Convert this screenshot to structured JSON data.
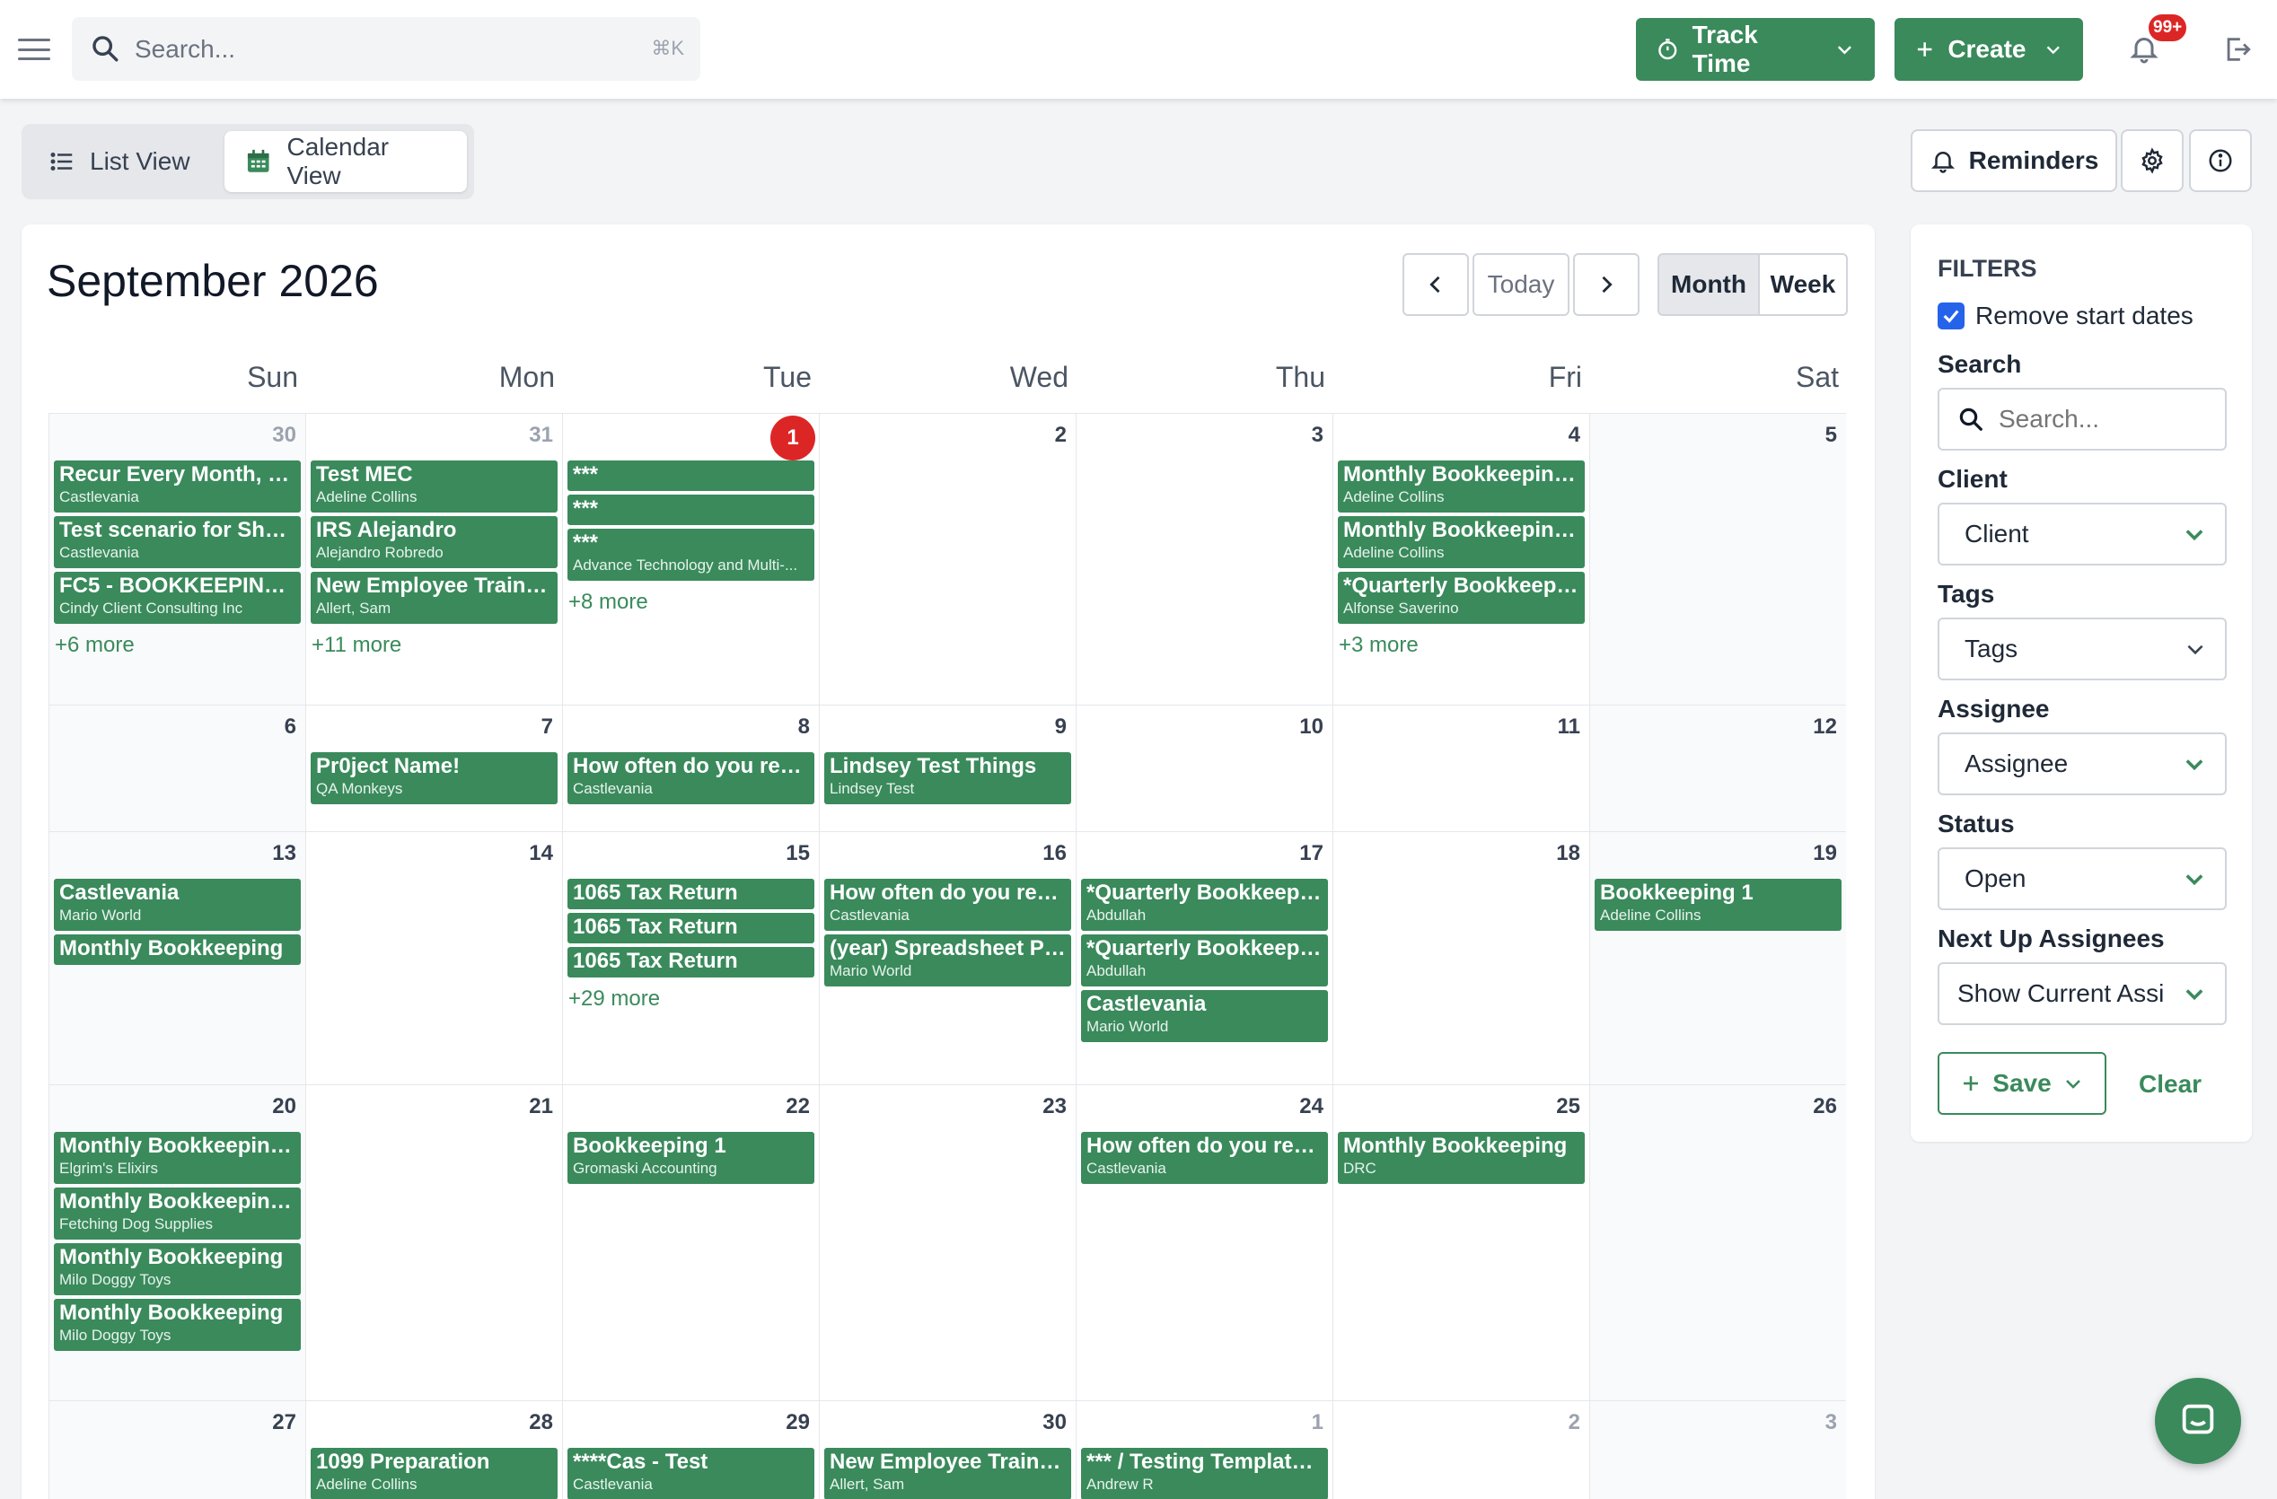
{
  "topbar": {
    "search_placeholder": "Search...",
    "search_shortcut": "⌘K",
    "track_time_label": "Track Time",
    "create_label": "Create",
    "notification_count": "99+"
  },
  "views": {
    "list_label": "List View",
    "calendar_label": "Calendar View"
  },
  "actions": {
    "reminders_label": "Reminders"
  },
  "calendar": {
    "title": "September 2026",
    "today_label": "Today",
    "month_label": "Month",
    "week_label": "Week",
    "weekdays": [
      "Sun",
      "Mon",
      "Tue",
      "Wed",
      "Thu",
      "Fri",
      "Sat"
    ],
    "weeks": [
      [
        {
          "day": "30",
          "muted": true,
          "events": [
            {
              "title": "Recur Every Month, se...",
              "sub": "Castlevania"
            },
            {
              "title": "Test scenario for Shaw...",
              "sub": "Castlevania"
            },
            {
              "title": "FC5 - BOOKKEEPING ...",
              "sub": "Cindy Client Consulting Inc"
            }
          ],
          "more": "+6 more"
        },
        {
          "day": "31",
          "muted": true,
          "events": [
            {
              "title": "Test MEC",
              "sub": "Adeline Collins"
            },
            {
              "title": "IRS Alejandro",
              "sub": "Alejandro Robredo"
            },
            {
              "title": "New Employee Trainin...",
              "sub": "Allert, Sam"
            }
          ],
          "more": "+11 more"
        },
        {
          "day": "1",
          "today": true,
          "events": [
            {
              "title": "***",
              "sub": ""
            },
            {
              "title": "***",
              "sub": ""
            },
            {
              "title": "***",
              "sub": "Advance Technology and Multi-..."
            }
          ],
          "more": "+8 more"
        },
        {
          "day": "2",
          "events": []
        },
        {
          "day": "3",
          "events": []
        },
        {
          "day": "4",
          "events": [
            {
              "title": "Monthly Bookkeeping -",
              "sub": "Adeline Collins"
            },
            {
              "title": "Monthly Bookkeeping -",
              "sub": "Adeline Collins"
            },
            {
              "title": "*Quarterly Bookkeeping",
              "sub": "Alfonse Saverino"
            }
          ],
          "more": "+3 more"
        },
        {
          "day": "5",
          "events": []
        }
      ],
      [
        {
          "day": "6",
          "events": []
        },
        {
          "day": "7",
          "events": [
            {
              "title": "Pr0ject Name!",
              "sub": "QA Monkeys"
            }
          ]
        },
        {
          "day": "8",
          "events": [
            {
              "title": "How often do you reoc...",
              "sub": "Castlevania"
            }
          ]
        },
        {
          "day": "9",
          "events": [
            {
              "title": "Lindsey Test Things",
              "sub": "Lindsey Test"
            }
          ]
        },
        {
          "day": "10",
          "events": []
        },
        {
          "day": "11",
          "events": []
        },
        {
          "day": "12",
          "events": []
        }
      ],
      [
        {
          "day": "13",
          "events": [
            {
              "title": "Castlevania",
              "sub": "Mario World"
            },
            {
              "title": "Monthly Bookkeeping",
              "sub": ""
            }
          ]
        },
        {
          "day": "14",
          "events": []
        },
        {
          "day": "15",
          "events": [
            {
              "title": "1065 Tax Return",
              "sub": ""
            },
            {
              "title": "1065 Tax Return",
              "sub": ""
            },
            {
              "title": "1065 Tax Return",
              "sub": ""
            }
          ],
          "more": "+29 more"
        },
        {
          "day": "16",
          "events": [
            {
              "title": "How often do you reoc...",
              "sub": "Castlevania"
            },
            {
              "title": "(year) Spreadsheet Pa...",
              "sub": "Mario World"
            }
          ]
        },
        {
          "day": "17",
          "events": [
            {
              "title": "*Quarterly Bookkeeping",
              "sub": "Abdullah"
            },
            {
              "title": "*Quarterly Bookkeeping",
              "sub": "Abdullah"
            },
            {
              "title": "Castlevania",
              "sub": "Mario World"
            }
          ]
        },
        {
          "day": "18",
          "events": []
        },
        {
          "day": "19",
          "events": [
            {
              "title": "Bookkeeping 1",
              "sub": "Adeline Collins"
            }
          ]
        }
      ],
      [
        {
          "day": "20",
          "events": [
            {
              "title": "Monthly Bookkeeping-...",
              "sub": "Elgrim's Elixirs"
            },
            {
              "title": "Monthly Bookkeeping-...",
              "sub": "Fetching Dog Supplies"
            },
            {
              "title": "Monthly Bookkeeping",
              "sub": "Milo Doggy Toys"
            },
            {
              "title": "Monthly Bookkeeping",
              "sub": "Milo Doggy Toys"
            }
          ]
        },
        {
          "day": "21",
          "events": []
        },
        {
          "day": "22",
          "events": [
            {
              "title": "Bookkeeping 1",
              "sub": "Gromaski Accounting"
            }
          ]
        },
        {
          "day": "23",
          "events": []
        },
        {
          "day": "24",
          "events": [
            {
              "title": "How often do you reoc...",
              "sub": "Castlevania"
            }
          ]
        },
        {
          "day": "25",
          "events": [
            {
              "title": "Monthly Bookkeeping",
              "sub": "DRC"
            }
          ]
        },
        {
          "day": "26",
          "events": []
        }
      ],
      [
        {
          "day": "27",
          "events": []
        },
        {
          "day": "28",
          "events": [
            {
              "title": "1099 Preparation",
              "sub": "Adeline Collins"
            }
          ]
        },
        {
          "day": "29",
          "events": [
            {
              "title": "****Cas - Test",
              "sub": "Castlevania"
            }
          ]
        },
        {
          "day": "30",
          "events": [
            {
              "title": "New Employee Trainin...",
              "sub": "Allert, Sam"
            }
          ]
        },
        {
          "day": "1",
          "muted": true,
          "events": [
            {
              "title": "*** / Testing Template ...",
              "sub": "Andrew R"
            }
          ]
        },
        {
          "day": "2",
          "muted": true,
          "events": []
        },
        {
          "day": "3",
          "muted": true,
          "events": []
        }
      ]
    ]
  },
  "filters": {
    "heading": "FILTERS",
    "remove_start_dates_label": "Remove start dates",
    "remove_start_dates_checked": true,
    "search_label": "Search",
    "search_placeholder": "Search...",
    "client_label": "Client",
    "client_value": "Client",
    "tags_label": "Tags",
    "tags_value": "Tags",
    "assignee_label": "Assignee",
    "assignee_value": "Assignee",
    "status_label": "Status",
    "status_value": "Open",
    "next_up_label": "Next Up Assignees",
    "next_up_value": "Show Current Assi",
    "save_label": "Save",
    "clear_label": "Clear"
  },
  "colors": {
    "accent": "#3a8a5c",
    "today": "#dc2626",
    "checkbox": "#2563eb"
  }
}
